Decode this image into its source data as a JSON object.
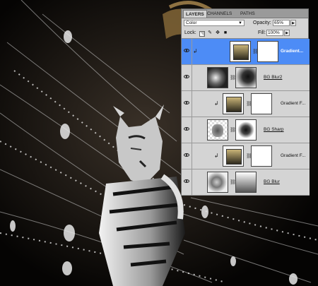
{
  "panel": {
    "tabs": [
      {
        "label": "LAYERS",
        "active": true
      },
      {
        "label": "CHANNELS",
        "active": false
      },
      {
        "label": "PATHS",
        "active": false
      }
    ],
    "blend_mode": "Color",
    "opacity_label": "Opacity:",
    "opacity_value": "65%",
    "lock_label": "Lock:",
    "fill_label": "Fill:",
    "fill_value": "100%",
    "caret": "▼",
    "stepper": "▶"
  },
  "layers": [
    {
      "name": "Gradient...",
      "type": "gradient-fill",
      "clipped": true,
      "selected": true
    },
    {
      "name": "BG Blur2",
      "type": "image-with-mask",
      "clipped": false,
      "selected": false
    },
    {
      "name": "Gradient F...",
      "type": "gradient-fill",
      "clipped": true,
      "selected": false
    },
    {
      "name": "BG Sharp",
      "type": "image-with-mask",
      "clipped": false,
      "selected": false
    },
    {
      "name": "Gradient F...",
      "type": "gradient-fill",
      "clipped": true,
      "selected": false
    },
    {
      "name": "BG Blur",
      "type": "image-with-mask",
      "clipped": false,
      "selected": false
    }
  ],
  "colors": {
    "panel_bg": "#d4d4d4",
    "selection": "#4d8cf6",
    "gradient_thumb_start": "#c9b478",
    "gradient_thumb_end": "#2e2a1e"
  }
}
